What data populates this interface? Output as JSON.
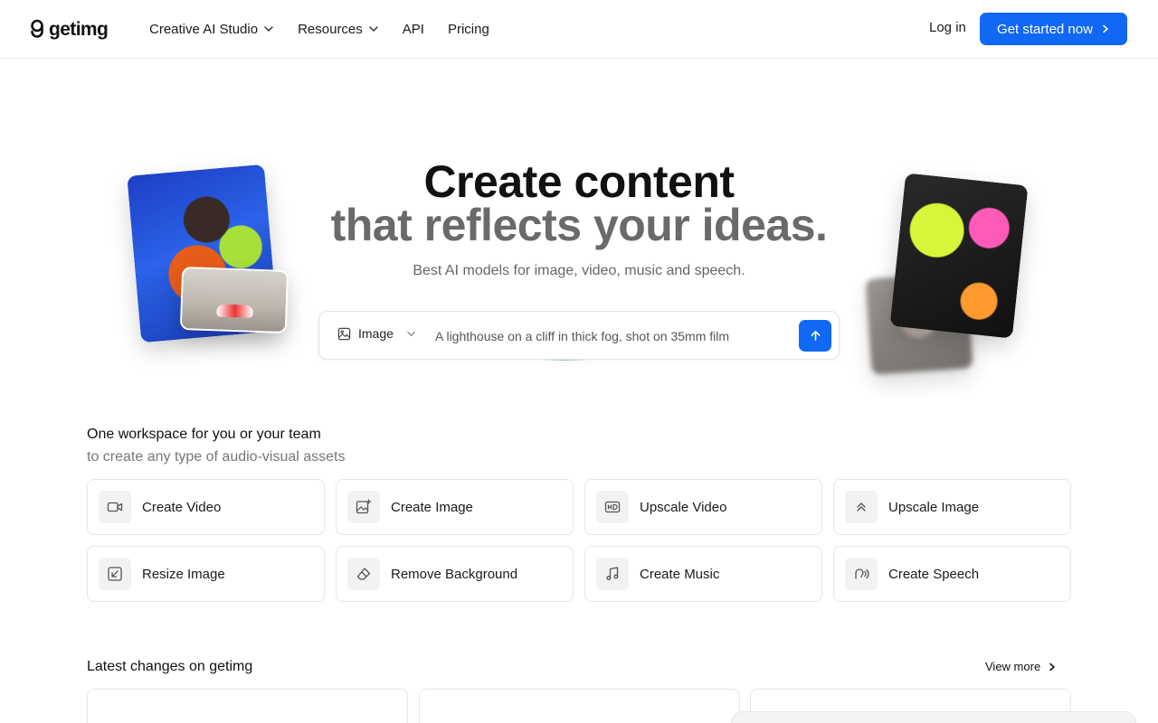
{
  "brand": {
    "name": "getimg"
  },
  "nav": {
    "items": [
      {
        "label": "Creative AI Studio",
        "dropdown": true
      },
      {
        "label": "Resources",
        "dropdown": true
      },
      {
        "label": "API",
        "dropdown": false
      },
      {
        "label": "Pricing",
        "dropdown": false
      }
    ],
    "login_label": "Log in",
    "cta_label": "Get started now"
  },
  "hero": {
    "title_line1": "Create content",
    "title_line2": "that reflects your ideas.",
    "subtitle": "Best AI models for image, video, music and speech."
  },
  "prompt": {
    "mode_label": "Image",
    "mode_icon": "image-icon",
    "placeholder": "A lighthouse on a cliff in thick fog, shot on 35mm film"
  },
  "workspace": {
    "title": "One workspace for you or your team",
    "subtitle": "to create any type of audio-visual assets",
    "tools": [
      {
        "label": "Create Video",
        "icon": "video-camera-icon"
      },
      {
        "label": "Create Image",
        "icon": "image-sparkle-icon"
      },
      {
        "label": "Upscale Video",
        "icon": "hd-icon"
      },
      {
        "label": "Upscale Image",
        "icon": "chevrons-up-icon"
      },
      {
        "label": "Resize Image",
        "icon": "resize-arrow-icon"
      },
      {
        "label": "Remove Background",
        "icon": "eraser-icon"
      },
      {
        "label": "Create Music",
        "icon": "music-note-icon"
      },
      {
        "label": "Create Speech",
        "icon": "speech-wave-icon"
      }
    ]
  },
  "latest": {
    "title": "Latest changes on getimg",
    "view_more_label": "View more"
  },
  "colors": {
    "accent": "#1068f5",
    "title_secondary": "#6a6a6a",
    "border": "#e5e5e5"
  }
}
